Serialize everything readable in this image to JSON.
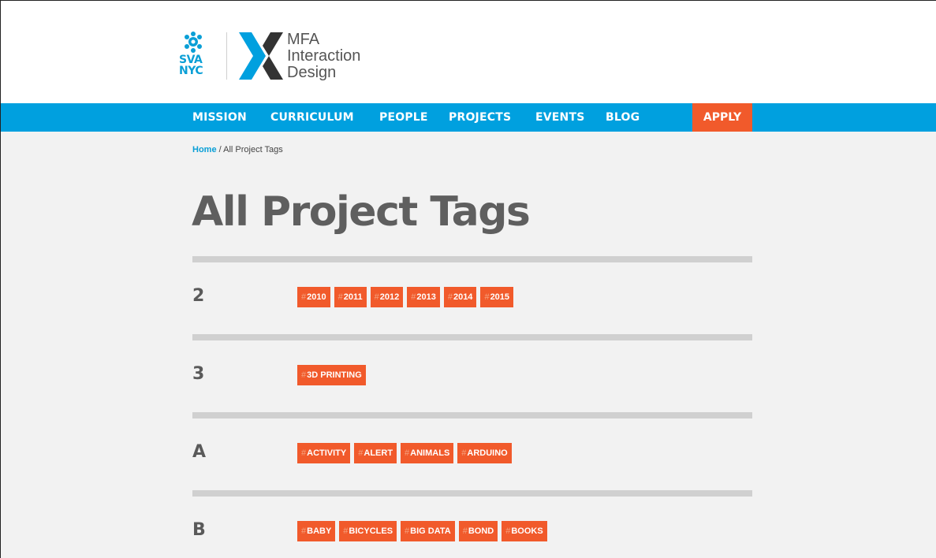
{
  "brand": {
    "school_top": "SVA",
    "school_bottom": "NYC",
    "program_line1": "MFA",
    "program_line2": "Interaction",
    "program_line3": "Design",
    "colors": {
      "blue": "#00a0df",
      "orange": "#f15a2b",
      "dark": "#333333"
    }
  },
  "nav": {
    "items": [
      "MISSION",
      "CURRICULUM",
      "PEOPLE",
      "PROJECTS",
      "EVENTS",
      "BLOG"
    ],
    "apply": "APPLY"
  },
  "breadcrumb": {
    "home": "Home",
    "separator": "/",
    "current": "All Project Tags"
  },
  "page": {
    "title": "All Project Tags"
  },
  "tag_groups": [
    {
      "letter": "2",
      "tags": [
        "2010",
        "2011",
        "2012",
        "2013",
        "2014",
        "2015"
      ]
    },
    {
      "letter": "3",
      "tags": [
        "3D PRINTING"
      ]
    },
    {
      "letter": "A",
      "tags": [
        "ACTIVITY",
        "ALERT",
        "ANIMALS",
        "ARDUINO"
      ]
    },
    {
      "letter": "B",
      "tags": [
        "BABY",
        "BICYCLES",
        "BIG DATA",
        "BOND",
        "BOOKS"
      ]
    }
  ],
  "tag_prefix": "#"
}
